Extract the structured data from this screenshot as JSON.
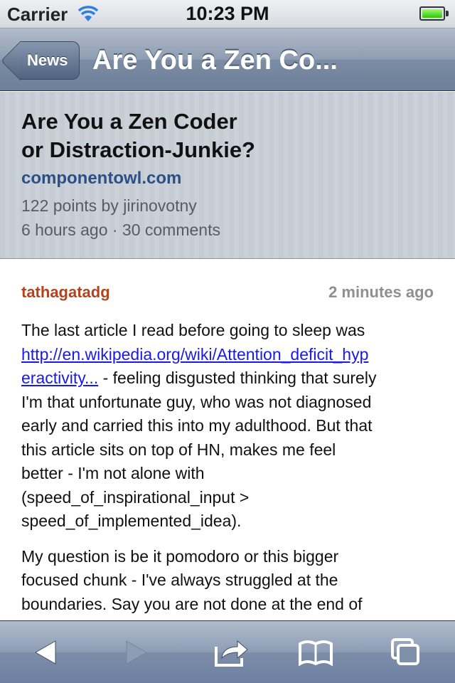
{
  "status_bar": {
    "carrier": "Carrier",
    "time": "10:23 PM",
    "battery_level": 1.0,
    "battery_color": "#4cd11a"
  },
  "nav": {
    "back_label": "News",
    "title": "Are You a Zen Co..."
  },
  "story": {
    "title_line1": "Are You a Zen Coder",
    "title_line2": "or Distraction-Junkie?",
    "domain": "componentowl.com",
    "points_line": "122 points by jirinovotny",
    "age_comments_line": "6 hours ago · 30 comments"
  },
  "comment": {
    "user": "tathagatadg",
    "time": "2 minutes ago",
    "para1_lead": "The last article I read before going to sleep was",
    "link_line1": "http://en.wikipedia.org/wiki/Attention_deficit_hyp",
    "link_line2": "eractivity...",
    "para1_after_link": " - feeling disgusted thinking that surely",
    "para1_line3": "I'm that unfortunate guy, who was not diagnosed",
    "para1_line4": "early and carried this into my adulthood. But that",
    "para1_line5": "this article sits on top of HN, makes me feel",
    "para1_line6": "better - I'm not alone with",
    "para1_line7": "(speed_of_inspirational_input >",
    "para1_line8": "speed_of_implemented_idea).",
    "para2_line1": "My question is be it pomodoro or this bigger",
    "para2_line2": "focused chunk - I've always struggled at the",
    "para2_line3": "boundaries. Say you are not done at the end of"
  },
  "toolbar": {
    "icons": [
      "back-arrow-icon",
      "forward-arrow-icon",
      "share-icon",
      "bookmarks-icon",
      "tabs-icon"
    ]
  },
  "colors": {
    "nav_blue": "#7b8ca4",
    "username": "#b2431f",
    "link": "#1a1ae8",
    "domain": "#2c4f88"
  }
}
